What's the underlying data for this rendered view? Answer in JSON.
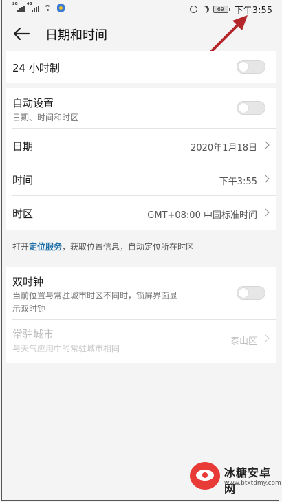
{
  "status_bar": {
    "net1": "2G",
    "net2": "4G",
    "battery": "69",
    "time": "下午3:55",
    "icons": [
      "signal-icon",
      "wifi-icon",
      "app-notification-icon",
      "alarm-icon",
      "moon-icon",
      "battery-icon"
    ]
  },
  "header": {
    "back_icon": "arrow-left-icon",
    "title": "日期和时间"
  },
  "sections": {
    "format": {
      "label": "24 小时制",
      "toggle_on": false
    },
    "auto": {
      "label": "自动设置",
      "sub": "日期、时间和时区",
      "toggle_on": false
    },
    "date": {
      "label": "日期",
      "value": "2020年1月18日"
    },
    "time": {
      "label": "时间",
      "value": "下午3:55"
    },
    "timezone": {
      "label": "时区",
      "value": "GMT+08:00 中国标准时间"
    }
  },
  "hint": {
    "prefix": "打开",
    "link": "定位服务",
    "suffix": "，获取位置信息，自动定位所在时区"
  },
  "dual_clock": {
    "label": "双时钟",
    "sub_line1": "当前位置与常驻城市时区不同时，锁屏界面显",
    "sub_line2": "示双时钟",
    "toggle_on": false
  },
  "home_city": {
    "label": "常驻城市",
    "sub": "与天气应用中的常驻城市相同",
    "value": "泰山区"
  },
  "watermark": {
    "name": "冰糖安卓网",
    "url": "www.btxtdmy.com"
  },
  "colors": {
    "link": "#1c6fa8",
    "annotation_arrow": "#b3262a",
    "background": "#f4f4f4"
  }
}
